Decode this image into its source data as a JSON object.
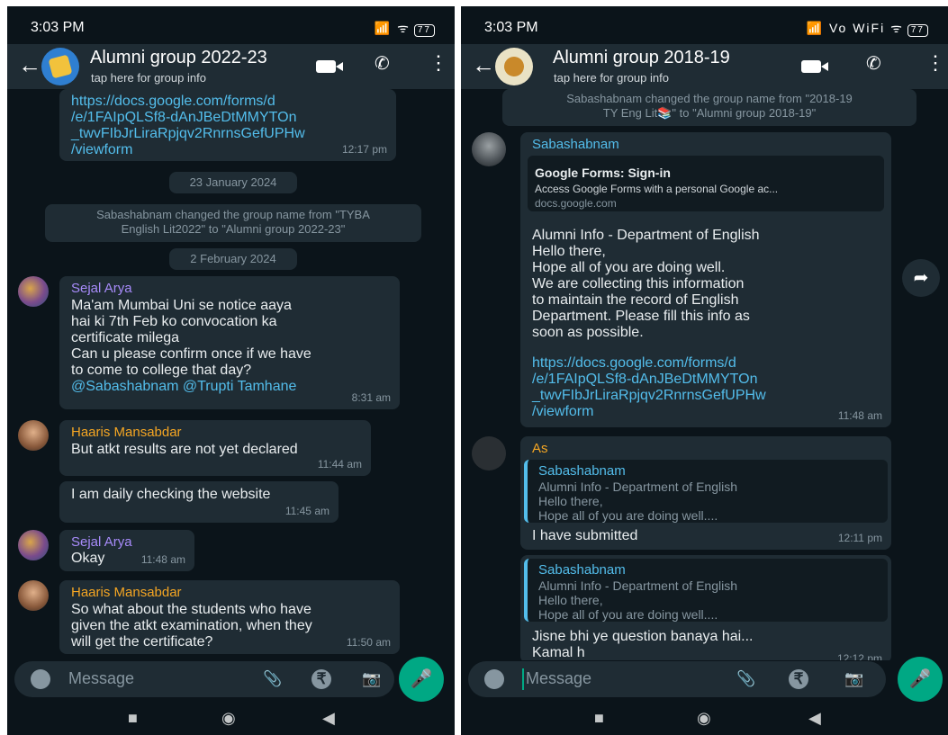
{
  "left": {
    "status_time": "3:03 PM",
    "status_icons": "📶 ᯤ",
    "battery": "77",
    "group_title": "Alumni group 2022-23",
    "group_sub": "tap here for group info",
    "link_msg": {
      "lines": [
        "https://docs.google.com/forms/d",
        "/e/1FAIpQLSf8-dAnJBeDtMMYTOn",
        "_twvFIbJrLiraRpjqv2RnrnsGefUPHw",
        "/viewform"
      ],
      "time": "12:17 pm"
    },
    "date1": "23 January 2024",
    "system_msg": [
      "Sabashabnam changed the group name from \"TYBA",
      "English Lit2022\" to \"Alumni group 2022-23\""
    ],
    "date2": "2 February 2024",
    "m1": {
      "sender": "Sejal Arya",
      "lines": [
        "Ma'am Mumbai Uni se notice aaya",
        "hai ki 7th Feb ko convocation ka",
        "certificate milega",
        "Can u please confirm once if we have",
        "to come to college that day?"
      ],
      "mentions": "@Sabashabnam @Trupti Tamhane",
      "time": "8:31 am"
    },
    "m2": {
      "sender": "Haaris Mansabdar",
      "text": "But atkt results are not yet declared",
      "time": "11:44 am"
    },
    "m3": {
      "text": "I am daily checking the website",
      "time": "11:45 am"
    },
    "m4": {
      "sender": "Sejal Arya",
      "text": "Okay",
      "time": "11:48 am"
    },
    "m5": {
      "sender": "Haaris Mansabdar",
      "lines": [
        "So what about the students who have",
        "given the atkt examination, when they",
        "will get the certificate?"
      ],
      "time": "11:50 am"
    },
    "input_placeholder": "Message"
  },
  "right": {
    "status_time": "3:03 PM",
    "status_icons": "📶 Vo WiFi ᯤ",
    "battery": "77",
    "group_title": "Alumni group 2018-19",
    "group_sub": "tap here for group info",
    "system_msg": [
      "Sabashabnam changed the group name from \"2018-19",
      "TY Eng Lit📚\" to \"Alumni group 2018-19\""
    ],
    "m1": {
      "sender": "Sabashabnam",
      "preview_title": "Google Forms: Sign-in",
      "preview_desc": "Access Google Forms with a personal Google ac...",
      "preview_domain": "docs.google.com",
      "lines": [
        "Alumni Info - Department of English",
        "Hello there,",
        "Hope all of you are doing well.",
        "We are collecting this information",
        "to maintain the record of English",
        "Department. Please fill this info as",
        "soon as possible."
      ],
      "link_lines": [
        "https://docs.google.com/forms/d",
        "/e/1FAIpQLSf8-dAnJBeDtMMYTOn",
        "_twvFIbJrLiraRpjqv2RnrnsGefUPHw",
        "/viewform"
      ],
      "time": "11:48 am"
    },
    "m2": {
      "sender": "As",
      "quote_sender": "Sabashabnam",
      "quote_lines": [
        "Alumni Info - Department of English",
        "Hello there,",
        "Hope all of you are doing well...."
      ],
      "text": "I have submitted",
      "time": "12:11 pm"
    },
    "m3": {
      "quote_sender": "Sabashabnam",
      "quote_lines": [
        "Alumni Info - Department of English",
        "Hello there,",
        "Hope all of you are doing well...."
      ],
      "lines": [
        "Jisne bhi ye question banaya hai...",
        "Kamal h"
      ],
      "time": "12:12 pm"
    },
    "input_placeholder": "Message"
  },
  "colors": {
    "bg": "#0b141a",
    "bubble": "#1f2c34",
    "link": "#53bdeb",
    "accent": "#00a884",
    "sejal": "#a78bfa",
    "haaris": "#f5a623",
    "sabashabnam": "#53bdeb",
    "as": "#f5a623"
  },
  "icons": [
    "back-arrow-icon",
    "video-call-icon",
    "phone-call-icon",
    "more-options-icon",
    "emoji-icon",
    "attach-icon",
    "rupee-icon",
    "camera-icon",
    "mic-icon",
    "forward-icon",
    "nav-square-icon",
    "nav-circle-icon",
    "nav-back-icon"
  ]
}
